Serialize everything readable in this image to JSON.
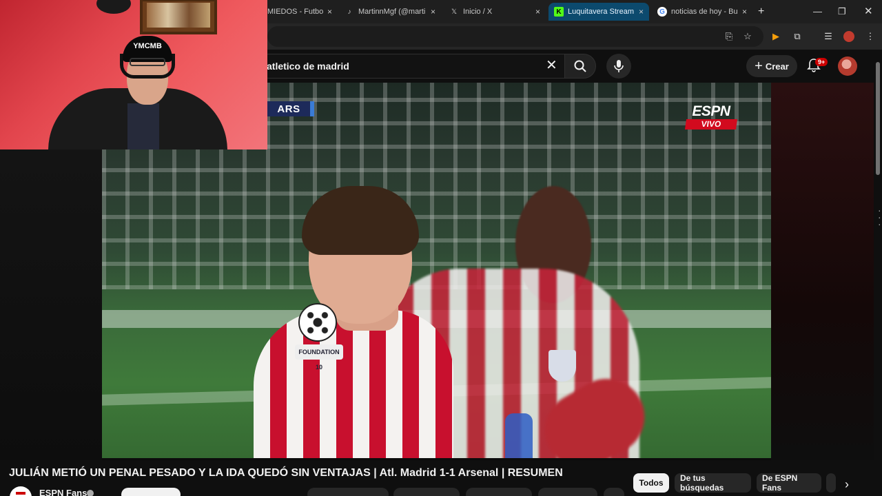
{
  "browser": {
    "tabs": [
      {
        "label": "MIEDOS - Futbol",
        "icon": "generic-tab-icon"
      },
      {
        "label": "MartinnMgf (@marti",
        "icon": "tiktok-icon"
      },
      {
        "label": "Inicio / X",
        "icon": "x-icon"
      },
      {
        "label": "Luquitavera Stream -",
        "icon": "kick-icon",
        "active": true
      },
      {
        "label": "noticias de hoy - Bus",
        "icon": "google-icon"
      }
    ],
    "new_tab": "+",
    "close": "×"
  },
  "youtube": {
    "search_value": "atletico de madrid",
    "create_label": "Crear",
    "notifications_badge": "9+",
    "video_title": "JULIÁN METIÓ UN PENAL PESADO Y LA IDA QUEDÓ SIN VENTAJAS | Atl. Madrid 1-1 Arsenal | RESUMEN",
    "channel_name": "ESPN Fans",
    "chips": [
      {
        "label": "Todos",
        "selected": true
      },
      {
        "label": "De tus búsquedas"
      },
      {
        "label": "De ESPN Fans"
      }
    ]
  },
  "video": {
    "score_team": "ARS",
    "broadcaster": "ESPN",
    "live_label": "VIVO",
    "sleeve_patch": "FOUNDATION 10"
  },
  "webcam": {
    "cap_text": "YMCMB"
  },
  "colors": {
    "active_tab": "#0c4a6e",
    "espn_red": "#d20a1e",
    "atleti_red": "#c8102e"
  }
}
